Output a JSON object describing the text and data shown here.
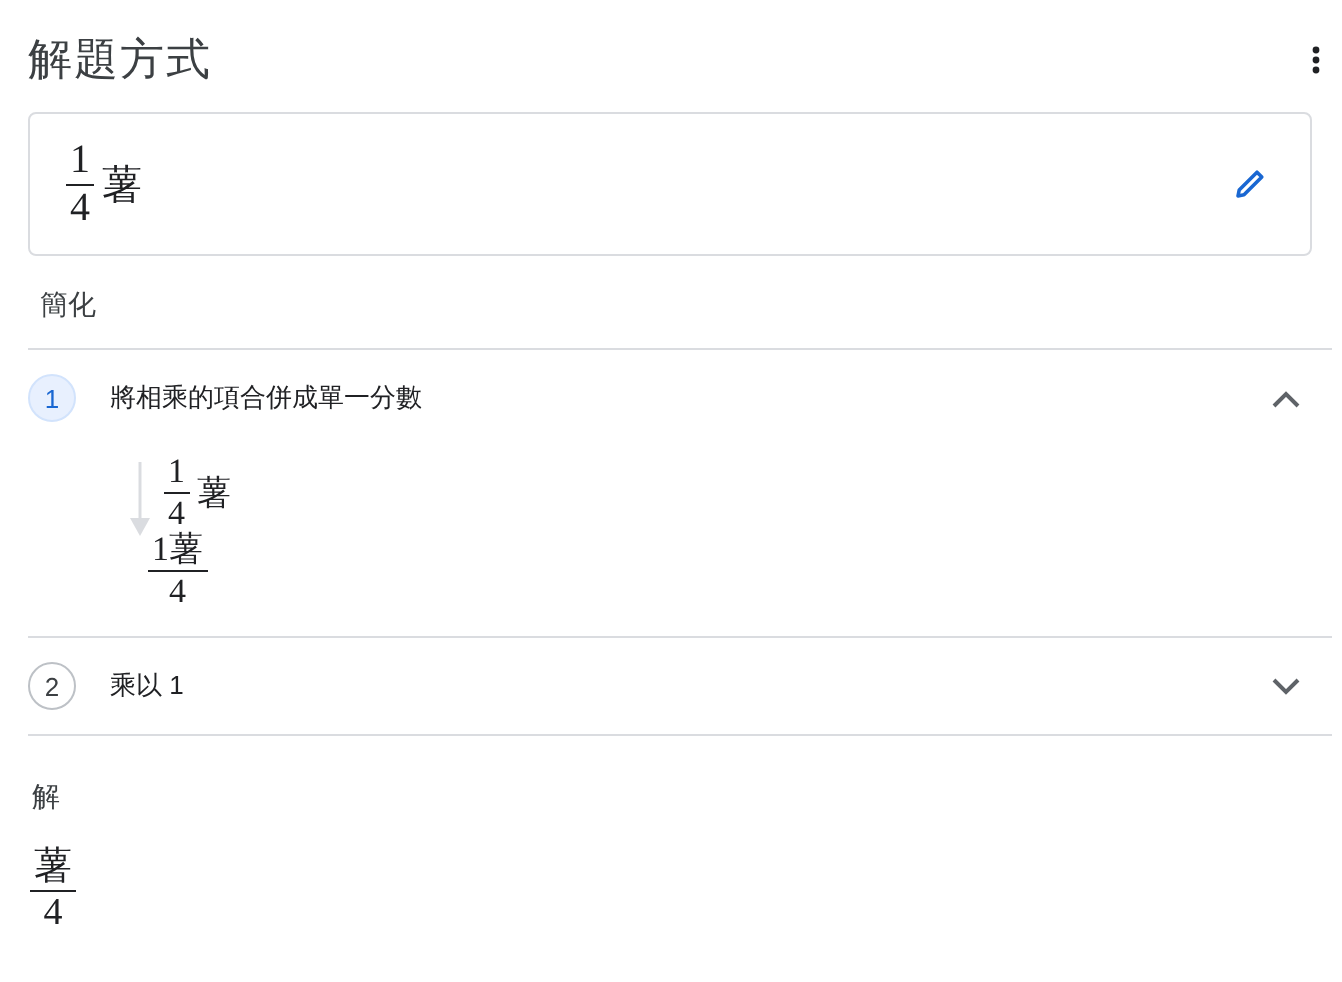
{
  "title": "解題方式",
  "problem": {
    "numerator": "1",
    "denominator": "4",
    "trailing": "薯"
  },
  "section_label": "簡化",
  "steps": [
    {
      "number": "1",
      "title": "將相乘的項合併成單一分數",
      "selected": true,
      "expanded": true,
      "before": {
        "numerator": "1",
        "denominator": "4",
        "trailing": "薯"
      },
      "after": {
        "numerator": "1薯",
        "denominator": "4"
      }
    },
    {
      "number": "2",
      "title": "乘以 1",
      "selected": false,
      "expanded": false
    }
  ],
  "solution_label": "解",
  "answer": {
    "numerator": "薯",
    "denominator": "4"
  }
}
